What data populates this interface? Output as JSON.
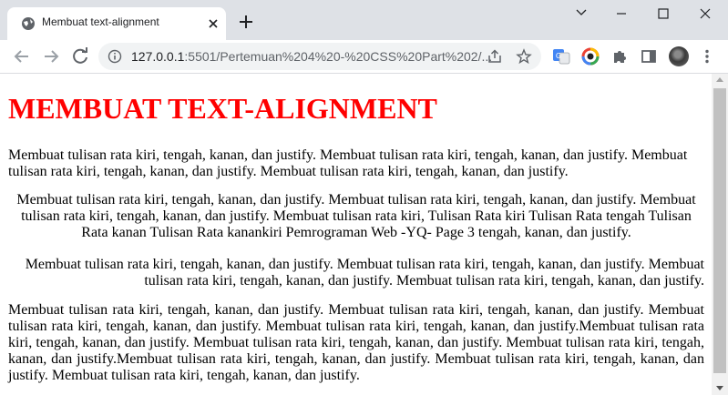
{
  "browser": {
    "tab": {
      "title": "Membuat text-alignment"
    },
    "address": {
      "host": "127.0.0.1",
      "path": ":5501/Pertemuan%204%20-%20CSS%20Part%202/..."
    },
    "icons": {
      "favicon": "globe-icon",
      "back": "arrow-left-icon",
      "forward": "arrow-right-icon",
      "reload": "reload-icon",
      "share": "share-icon",
      "bookmark": "star-icon",
      "translate": "google-translate-icon",
      "extension_color": "color-picker-extension-icon",
      "extensions": "puzzle-icon",
      "side_panel": "side-panel-icon",
      "menu": "kebab-menu-icon"
    }
  },
  "page": {
    "heading": "MEMBUAT TEXT-ALIGNMENT",
    "heading_color": "#ff0000",
    "paragraphs": {
      "left": "Membuat tulisan rata kiri, tengah, kanan, dan justify. Membuat tulisan rata kiri, tengah, kanan, dan justify. Membuat tulisan rata kiri, tengah, kanan, dan justify. Membuat tulisan rata kiri, tengah, kanan, dan justify.",
      "center": "Membuat tulisan rata kiri, tengah, kanan, dan justify. Membuat tulisan rata kiri, tengah, kanan, dan justify. Membuat tulisan rata kiri, tengah, kanan, dan justify. Membuat tulisan rata kiri, Tulisan Rata kiri Tulisan Rata tengah Tulisan Rata kanan Tulisan Rata kanankiri Pemrograman Web -YQ- Page 3 tengah, kanan, dan justify.",
      "right": "Membuat tulisan rata kiri, tengah, kanan, dan justify. Membuat tulisan rata kiri, tengah, kanan, dan justify. Membuat tulisan rata kiri, tengah, kanan, dan justify. Membuat tulisan rata kiri, tengah, kanan, dan justify.",
      "justify": "Membuat tulisan rata kiri, tengah, kanan, dan justify. Membuat tulisan rata kiri, tengah, kanan, dan justify. Membuat tulisan rata kiri, tengah, kanan, dan justify. Membuat tulisan rata kiri, tengah, kanan, dan justify.Membuat tulisan rata kiri, tengah, kanan, dan justify. Membuat tulisan rata kiri, tengah, kanan, dan justify. Membuat tulisan rata kiri, tengah, kanan, dan justify.Membuat tulisan rata kiri, tengah, kanan, dan justify. Membuat tulisan rata kiri, tengah, kanan, dan justify. Membuat tulisan rata kiri, tengah, kanan, dan justify."
    }
  }
}
